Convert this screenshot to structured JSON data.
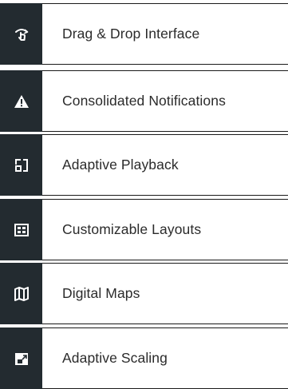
{
  "features": {
    "items": [
      {
        "label": "Drag & Drop Interface",
        "icon": "touch-swipe-icon"
      },
      {
        "label": "Consolidated Notifications",
        "icon": "warning-icon"
      },
      {
        "label": "Adaptive Playback",
        "icon": "fullscreen-frame-icon"
      },
      {
        "label": "Customizable Layouts",
        "icon": "layout-grid-icon"
      },
      {
        "label": "Digital Maps",
        "icon": "map-icon"
      },
      {
        "label": "Adaptive Scaling",
        "icon": "scaling-screen-icon"
      }
    ]
  },
  "colors": {
    "icon_background": "#232b30",
    "icon_foreground": "#ffffff",
    "text": "#2b2b2b",
    "border": "#1a1a1a"
  }
}
